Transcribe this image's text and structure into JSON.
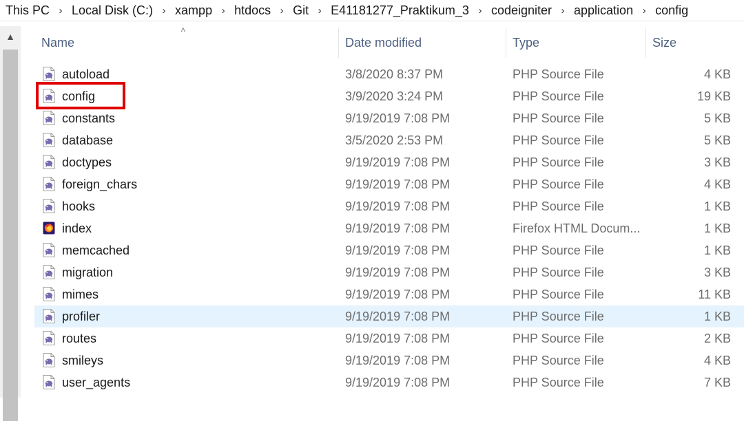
{
  "breadcrumb": [
    "This PC",
    "Local Disk (C:)",
    "xampp",
    "htdocs",
    "Git",
    "E41181277_Praktikum_3",
    "codeigniter",
    "application",
    "config"
  ],
  "separator": "›",
  "columns": {
    "name": "Name",
    "date": "Date modified",
    "type": "Type",
    "size": "Size"
  },
  "files": [
    {
      "name": "autoload",
      "date": "3/8/2020 8:37 PM",
      "type": "PHP Source File",
      "size": "4 KB",
      "icon": "php-file-icon"
    },
    {
      "name": "config",
      "date": "3/9/2020 3:24 PM",
      "type": "PHP Source File",
      "size": "19 KB",
      "icon": "php-file-icon"
    },
    {
      "name": "constants",
      "date": "9/19/2019 7:08 PM",
      "type": "PHP Source File",
      "size": "5 KB",
      "icon": "php-file-icon"
    },
    {
      "name": "database",
      "date": "3/5/2020 2:53 PM",
      "type": "PHP Source File",
      "size": "5 KB",
      "icon": "php-file-icon"
    },
    {
      "name": "doctypes",
      "date": "9/19/2019 7:08 PM",
      "type": "PHP Source File",
      "size": "3 KB",
      "icon": "php-file-icon"
    },
    {
      "name": "foreign_chars",
      "date": "9/19/2019 7:08 PM",
      "type": "PHP Source File",
      "size": "4 KB",
      "icon": "php-file-icon"
    },
    {
      "name": "hooks",
      "date": "9/19/2019 7:08 PM",
      "type": "PHP Source File",
      "size": "1 KB",
      "icon": "php-file-icon"
    },
    {
      "name": "index",
      "date": "9/19/2019 7:08 PM",
      "type": "Firefox HTML Docum...",
      "size": "1 KB",
      "icon": "firefox-html-icon"
    },
    {
      "name": "memcached",
      "date": "9/19/2019 7:08 PM",
      "type": "PHP Source File",
      "size": "1 KB",
      "icon": "php-file-icon"
    },
    {
      "name": "migration",
      "date": "9/19/2019 7:08 PM",
      "type": "PHP Source File",
      "size": "3 KB",
      "icon": "php-file-icon"
    },
    {
      "name": "mimes",
      "date": "9/19/2019 7:08 PM",
      "type": "PHP Source File",
      "size": "11 KB",
      "icon": "php-file-icon"
    },
    {
      "name": "profiler",
      "date": "9/19/2019 7:08 PM",
      "type": "PHP Source File",
      "size": "1 KB",
      "icon": "php-file-icon",
      "selected": true
    },
    {
      "name": "routes",
      "date": "9/19/2019 7:08 PM",
      "type": "PHP Source File",
      "size": "2 KB",
      "icon": "php-file-icon"
    },
    {
      "name": "smileys",
      "date": "9/19/2019 7:08 PM",
      "type": "PHP Source File",
      "size": "4 KB",
      "icon": "php-file-icon"
    },
    {
      "name": "user_agents",
      "date": "9/19/2019 7:08 PM",
      "type": "PHP Source File",
      "size": "7 KB",
      "icon": "php-file-icon"
    }
  ],
  "highlighted_file": "config",
  "colors": {
    "highlight": "#e00000",
    "selected_row": "#e5f3ff",
    "header_text": "#4d6082",
    "php_icon": "#7a6bb0",
    "firefox_icon_dark": "#2b1a6b",
    "firefox_icon_flame": "#ff7a18"
  }
}
